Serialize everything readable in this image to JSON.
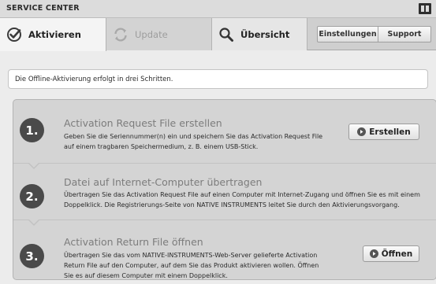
{
  "window": {
    "title": "SERVICE CENTER",
    "logo_icon": "native-instruments-logo-icon"
  },
  "tabs": [
    {
      "label": "Aktivieren",
      "icon": "check-icon",
      "active": true
    },
    {
      "label": "Update",
      "icon": "refresh-icon",
      "active": false
    },
    {
      "label": "Übersicht",
      "icon": "magnifier-icon",
      "active": false
    }
  ],
  "header_buttons": {
    "settings": "Einstellungen",
    "support": "Support"
  },
  "info": "Die Offline-Aktivierung erfolgt in drei Schritten.",
  "steps": [
    {
      "number": "1.",
      "title": "Activation Request File erstellen",
      "description": "Geben Sie die Seriennummer(n) ein und speichern Sie das Activation Request File auf einem tragbaren Speichermedium, z. B. einem USB-Stick.",
      "button": "Erstellen"
    },
    {
      "number": "2.",
      "title": "Datei auf Internet-Computer übertragen",
      "description": "Übertragen Sie das Activation Request File auf einen Computer mit Internet-Zugang und öffnen Sie es mit einem Doppelklick. Die Registrierungs-Seite von NATIVE INSTRUMENTS leitet Sie durch den Aktivierungsvorgang."
    },
    {
      "number": "3.",
      "title": "Activation Return File öffnen",
      "description": "Übertragen Sie das vom NATIVE-INSTRUMENTS-Web-Server gelieferte Activation Return File auf den Computer, auf dem Sie das Produkt aktivieren wollen. Öffnen Sie es auf diesem Computer mit einem Doppelklick.",
      "button": "Öffnen"
    }
  ]
}
